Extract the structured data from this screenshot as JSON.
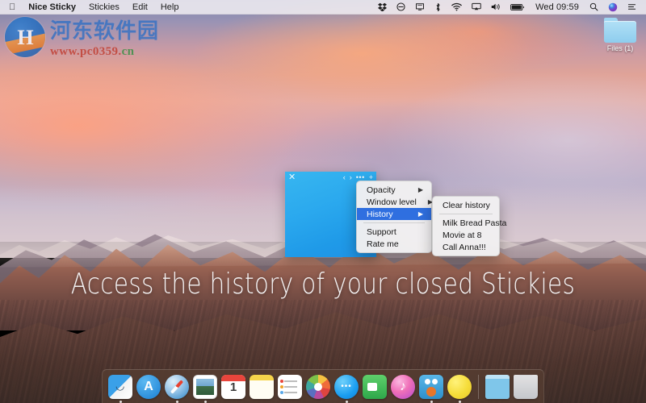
{
  "menubar": {
    "apple_icon": "apple-logo-icon",
    "items": [
      {
        "label": "Nice Sticky",
        "bold": true
      },
      {
        "label": "Stickies",
        "bold": false
      },
      {
        "label": "Edit",
        "bold": false
      },
      {
        "label": "Help",
        "bold": false
      }
    ],
    "status_icons": [
      "dropbox-icon",
      "do-not-disturb-icon",
      "display-mirroring-icon",
      "bluetooth-icon",
      "wifi-icon",
      "airplay-icon",
      "volume-icon",
      "battery-icon"
    ],
    "clock": "Wed 09:59",
    "search_icon": "spotlight-search-icon",
    "siri_icon": "siri-icon",
    "notification_icon": "notification-center-icon"
  },
  "desktop": {
    "folder": {
      "label": "Files",
      "badge": "(1)",
      "icon": "folder-icon"
    }
  },
  "watermark": {
    "logo_glyph": "H",
    "site_name": "河东软件园",
    "url_prefix": "www.pc0359.",
    "url_suffix": "cn"
  },
  "sticky_note": {
    "close_icon": "close-icon",
    "prev_icon": "‹",
    "next_icon": "›",
    "more_icon": "•••",
    "add_icon": "+",
    "color": "#2ba9ee",
    "text": ""
  },
  "context_menu": {
    "items": [
      {
        "label": "Opacity",
        "submenu": true,
        "highlighted": false
      },
      {
        "label": "Window level",
        "submenu": true,
        "highlighted": false
      },
      {
        "label": "History",
        "submenu": true,
        "highlighted": true
      },
      {
        "separator": true
      },
      {
        "label": "Support",
        "submenu": false,
        "highlighted": false
      },
      {
        "label": "Rate me",
        "submenu": false,
        "highlighted": false
      }
    ],
    "arrow_glyph": "▶",
    "highlight_color": "#2f6fe0"
  },
  "history_submenu": {
    "items": [
      {
        "label": "Clear history"
      },
      {
        "separator": true
      },
      {
        "label": "Milk Bread Pasta"
      },
      {
        "label": "Movie at 8"
      },
      {
        "label": "Call Anna!!!"
      }
    ]
  },
  "tagline": "Access the history of your closed Stickies",
  "dock": {
    "items": [
      {
        "name": "finder",
        "class": "ic-finder",
        "running": true
      },
      {
        "name": "app-store",
        "class": "ic-appstore",
        "running": false
      },
      {
        "name": "safari",
        "class": "ic-safari",
        "running": true
      },
      {
        "name": "preview",
        "class": "ic-preview",
        "running": true
      },
      {
        "name": "calendar",
        "class": "ic-calendar",
        "running": false,
        "day": "1"
      },
      {
        "name": "notes",
        "class": "ic-notes",
        "running": false
      },
      {
        "name": "reminders",
        "class": "ic-reminders",
        "running": false
      },
      {
        "name": "photos",
        "class": "ic-photos",
        "running": false
      },
      {
        "name": "messages",
        "class": "ic-messages",
        "running": true
      },
      {
        "name": "facetime",
        "class": "ic-facetime",
        "running": false
      },
      {
        "name": "itunes",
        "class": "ic-itunes",
        "running": false
      },
      {
        "name": "tweetbot",
        "class": "ic-tweetbot",
        "running": true
      },
      {
        "name": "nice-sticky",
        "class": "ic-yellow",
        "running": true
      }
    ],
    "right_items": [
      {
        "name": "downloads-folder",
        "class": "ic-dlfolder"
      },
      {
        "name": "trash",
        "class": "ic-trash"
      }
    ]
  }
}
